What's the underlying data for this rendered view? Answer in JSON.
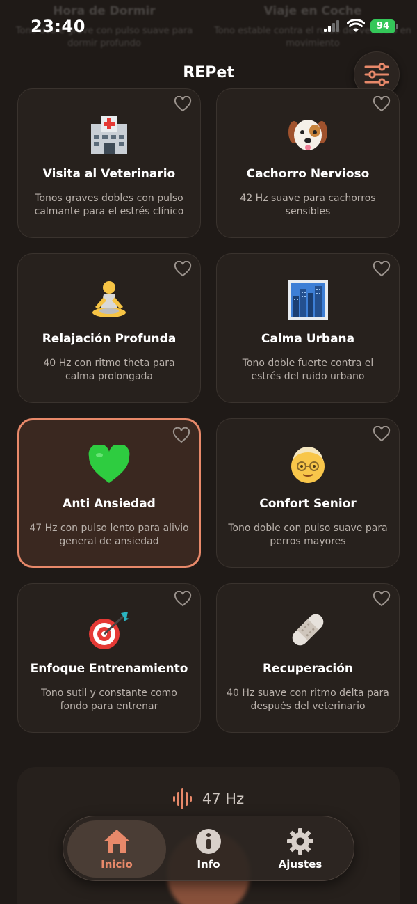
{
  "background_cards": [
    {
      "title": "Hora de Dormir",
      "subtitle": "Tono doble grave con pulso suave para dormir profundo"
    },
    {
      "title": "Viaje en Coche",
      "subtitle": "Tono estable contra el ruido del vehículo en movimiento"
    }
  ],
  "status": {
    "time": "23:40",
    "battery": "94"
  },
  "header": {
    "title": "REPet",
    "settings_icon": "sliders-icon"
  },
  "cards": [
    {
      "name": "Visita al Veterinario",
      "desc": "Tonos graves dobles con pulso calmante para el estrés clínico",
      "icon": "hospital"
    },
    {
      "name": "Cachorro Nervioso",
      "desc": "42 Hz suave para cachorros sensibles",
      "icon": "dog-face"
    },
    {
      "name": "Relajación Profunda",
      "desc": "40 Hz con ritmo theta para calma prolongada",
      "icon": "meditation"
    },
    {
      "name": "Calma Urbana",
      "desc": "Tono doble fuerte contra el estrés del ruido urbano",
      "icon": "cityscape"
    },
    {
      "name": "Anti Ansiedad",
      "desc": "47 Hz con pulso lento para alivio general de ansiedad",
      "icon": "green-heart",
      "selected": true
    },
    {
      "name": "Confort Senior",
      "desc": "Tono doble con pulso suave para perros mayores",
      "icon": "older-person"
    },
    {
      "name": "Enfoque Entrenamiento",
      "desc": "Tono sutil y constante como fondo para entrenar",
      "icon": "target"
    },
    {
      "name": "Recuperación",
      "desc": "40 Hz suave con ritmo delta para después del veterinario",
      "icon": "bandage"
    }
  ],
  "player": {
    "frequency": "47 Hz"
  },
  "tabs": {
    "home": {
      "label": "Inicio",
      "active": true
    },
    "info": {
      "label": "Info"
    },
    "settings": {
      "label": "Ajustes"
    }
  },
  "colors": {
    "accent": "#e8896a",
    "background": "#1f1a17",
    "card": "#27211d",
    "battery": "#34c759"
  }
}
